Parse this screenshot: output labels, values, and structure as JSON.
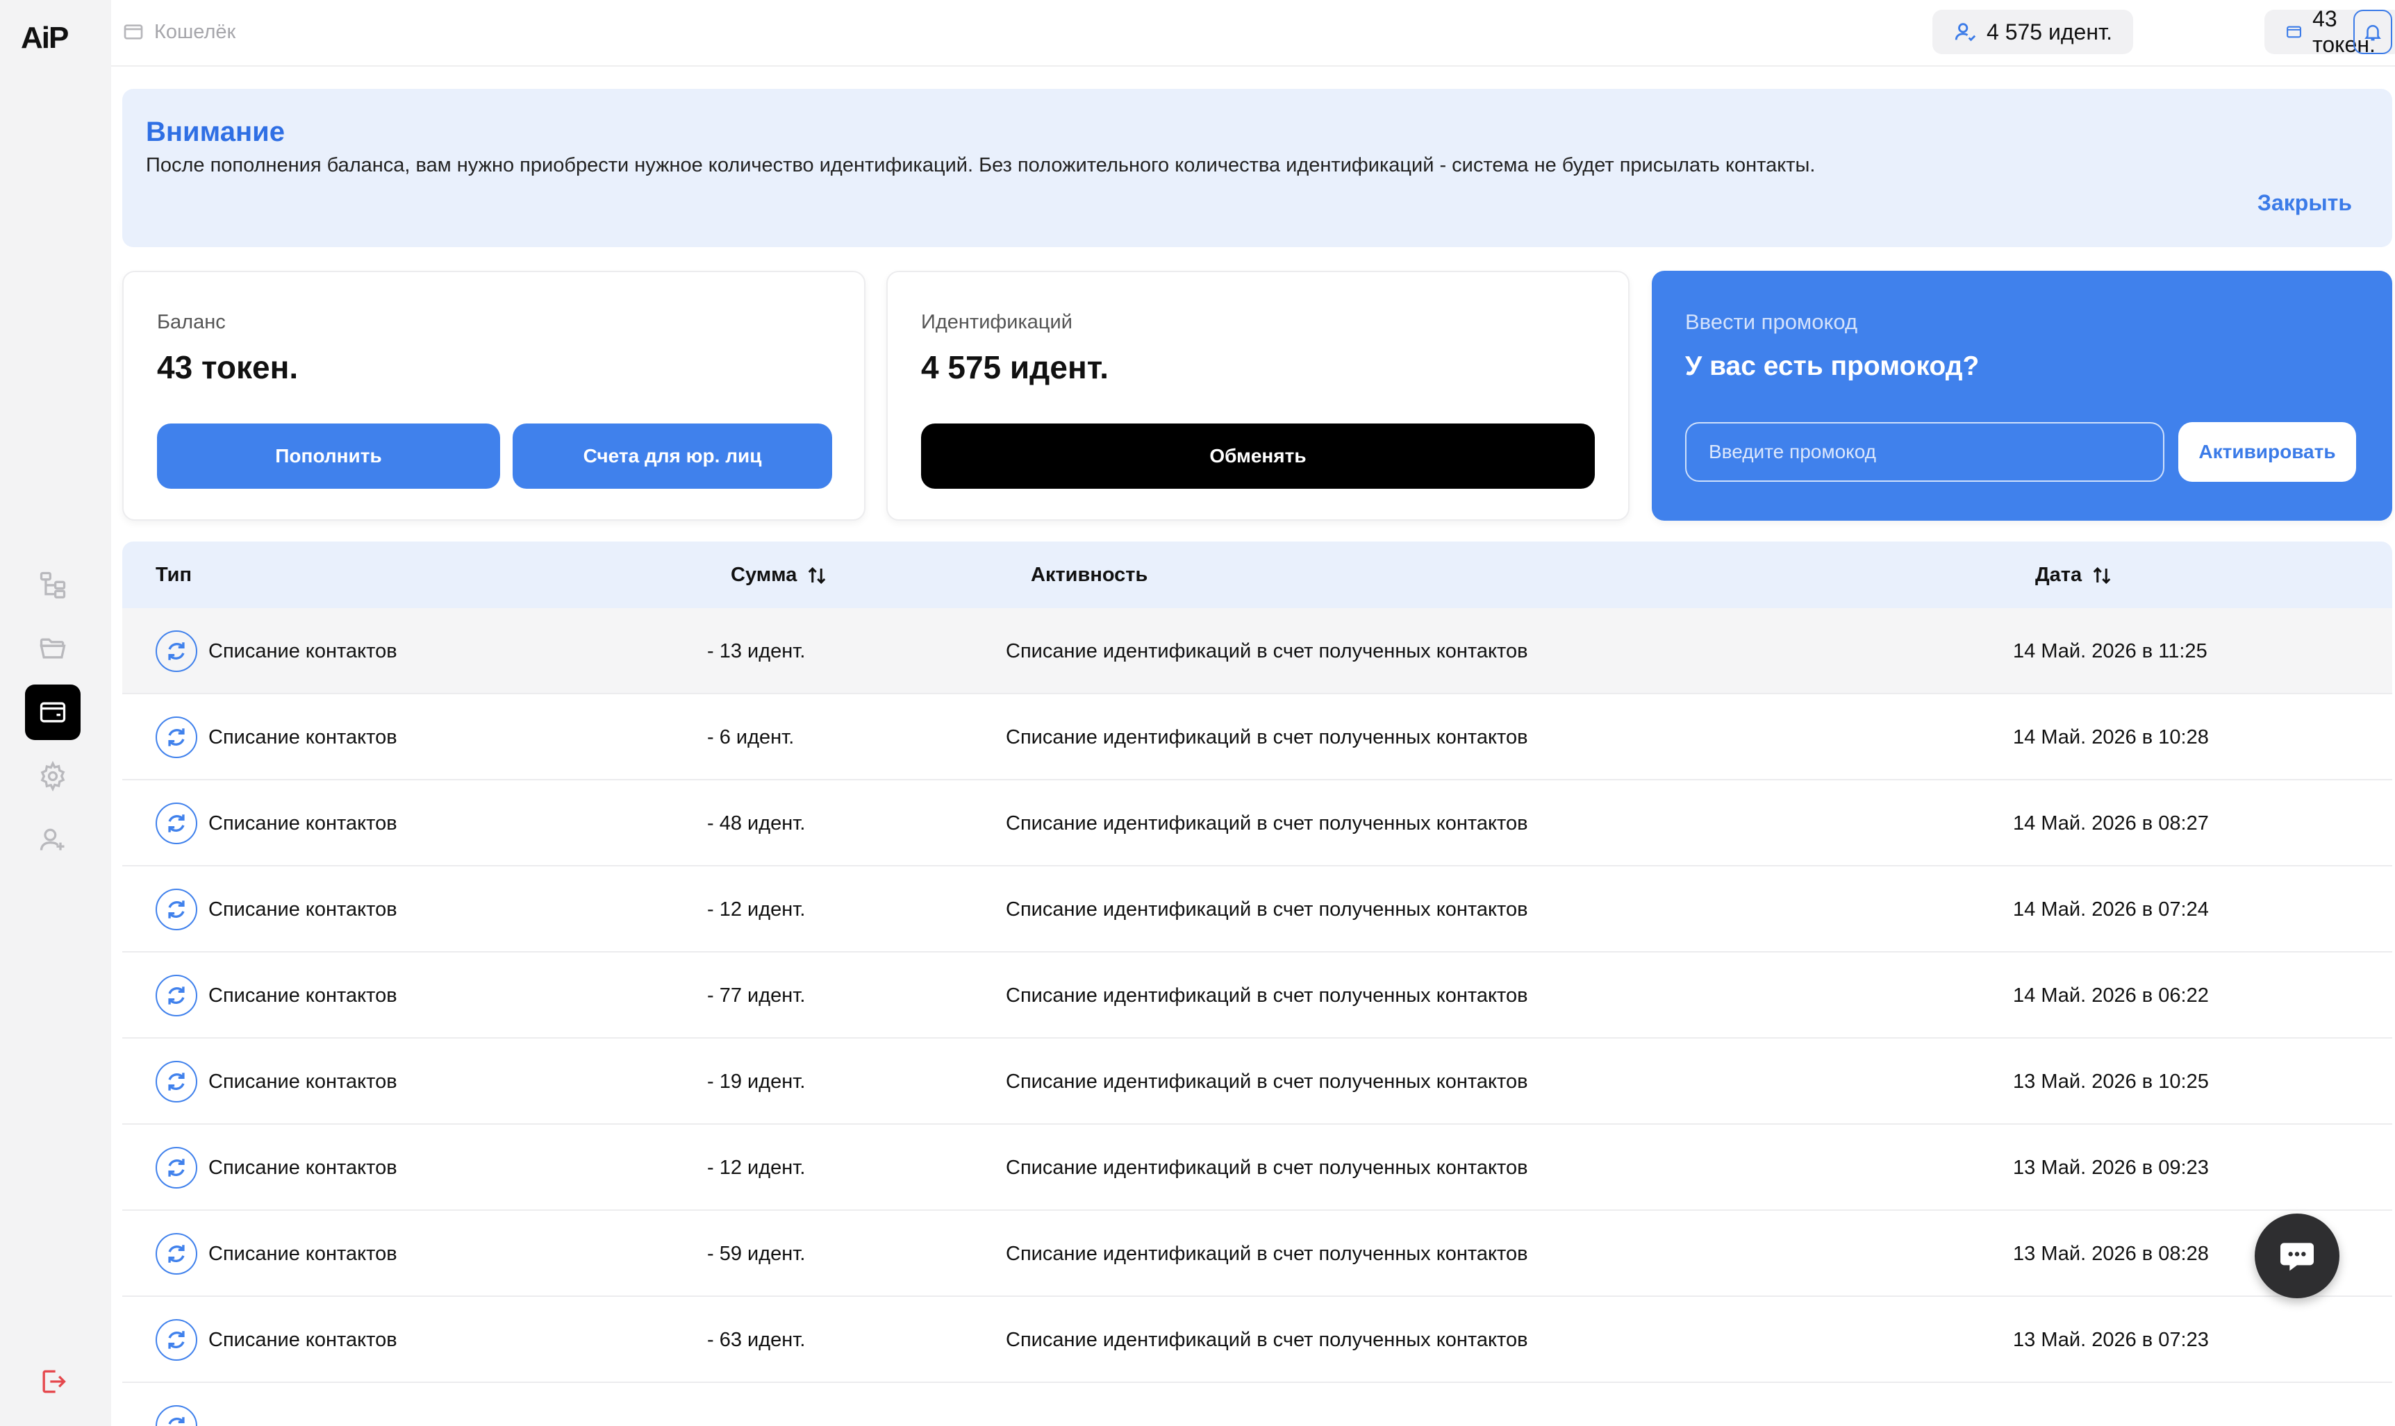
{
  "brand": {
    "logo": "AiP"
  },
  "topbar": {
    "breadcrumb": "Кошелёк",
    "ident_pill": "4 575 идент.",
    "token_pill": "43 токен."
  },
  "notice": {
    "title": "Внимание",
    "text": "После пополнения баланса, вам нужно приобрести нужное количество идентификаций. Без положительного количества идентификаций - система не будет присылать контакты.",
    "close": "Закрыть"
  },
  "balance_card": {
    "label": "Баланс",
    "value": "43 токен.",
    "topup_button": "Пополнить",
    "invoice_button": "Счета для юр. лиц"
  },
  "ident_card": {
    "label": "Идентификаций",
    "value": "4 575 идент.",
    "exchange_button": "Обменять"
  },
  "promo_card": {
    "label": "Ввести промокод",
    "question": "У вас есть промокод?",
    "placeholder": "Введите промокод",
    "activate_button": "Активировать"
  },
  "table": {
    "headers": {
      "type": "Тип",
      "amount": "Сумма",
      "activity": "Активность",
      "date": "Дата"
    },
    "rows": [
      {
        "type": "Списание контактов",
        "amount": "- 13 идент.",
        "activity": "Списание идентификаций в счет полученных контактов",
        "date": "14 Май. 2026 в 11:25"
      },
      {
        "type": "Списание контактов",
        "amount": "- 6 идент.",
        "activity": "Списание идентификаций в счет полученных контактов",
        "date": "14 Май. 2026 в 10:28"
      },
      {
        "type": "Списание контактов",
        "amount": "- 48 идент.",
        "activity": "Списание идентификаций в счет полученных контактов",
        "date": "14 Май. 2026 в 08:27"
      },
      {
        "type": "Списание контактов",
        "amount": "- 12 идент.",
        "activity": "Списание идентификаций в счет полученных контактов",
        "date": "14 Май. 2026 в 07:24"
      },
      {
        "type": "Списание контактов",
        "amount": "- 77 идент.",
        "activity": "Списание идентификаций в счет полученных контактов",
        "date": "14 Май. 2026 в 06:22"
      },
      {
        "type": "Списание контактов",
        "amount": "- 19 идент.",
        "activity": "Списание идентификаций в счет полученных контактов",
        "date": "13 Май. 2026 в 10:25"
      },
      {
        "type": "Списание контактов",
        "amount": "- 12 идент.",
        "activity": "Списание идентификаций в счет полученных контактов",
        "date": "13 Май. 2026 в 09:23"
      },
      {
        "type": "Списание контактов",
        "amount": "- 59 идент.",
        "activity": "Списание идентификаций в счет полученных контактов",
        "date": "13 Май. 2026 в 08:28"
      },
      {
        "type": "Списание контактов",
        "amount": "- 63 идент.",
        "activity": "Списание идентификаций в счет полученных контактов",
        "date": "13 Май. 2026 в 07:23"
      }
    ]
  },
  "icons": {
    "sidebar": [
      "hierarchy-icon",
      "folder-icon",
      "wallet-icon",
      "gear-icon",
      "add-user-icon",
      "logout-icon"
    ],
    "accent": "#4081ec",
    "danger": "#e5484d"
  }
}
